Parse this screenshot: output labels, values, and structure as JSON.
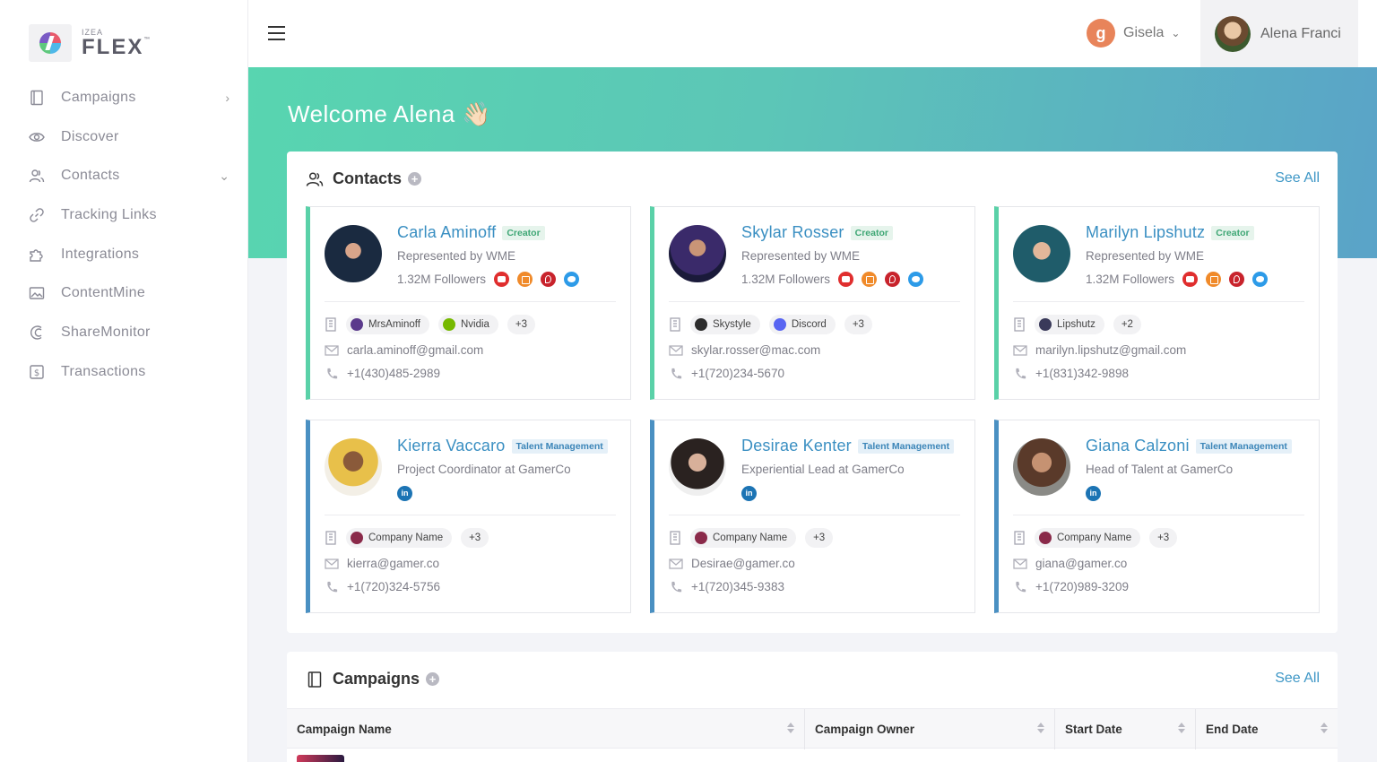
{
  "brand": {
    "small": "IZEA",
    "name": "FLEX",
    "tm": "™"
  },
  "sidebar": {
    "items": [
      {
        "label": "Campaigns",
        "icon": "book-icon",
        "chevron": "›"
      },
      {
        "label": "Discover",
        "icon": "eye-icon"
      },
      {
        "label": "Contacts",
        "icon": "users-icon",
        "chevron": "⌄"
      },
      {
        "label": "Tracking Links",
        "icon": "link-icon"
      },
      {
        "label": "Integrations",
        "icon": "puzzle-icon"
      },
      {
        "label": "ContentMine",
        "icon": "image-icon"
      },
      {
        "label": "ShareMonitor",
        "icon": "crescent-icon"
      },
      {
        "label": "Transactions",
        "icon": "dollar-icon"
      }
    ]
  },
  "topbar": {
    "org": {
      "initial": "g",
      "name": "Gisela",
      "color": "#e8845a"
    },
    "user": {
      "name": "Alena Franci"
    }
  },
  "banner": {
    "welcome": "Welcome Alena 👋🏻"
  },
  "contacts": {
    "title": "Contacts",
    "see_all": "See All",
    "cards": [
      {
        "name": "Carla Aminoff",
        "tag": "Creator",
        "subtitle": "Represented by WME",
        "followers": "1.32M Followers",
        "chips": [
          {
            "label": "MrsAminoff",
            "color": "#5b3a8c"
          },
          {
            "label": "Nvidia",
            "color": "#76b900"
          }
        ],
        "more": "+3",
        "email": "carla.aminoff@gmail.com",
        "phone": "+1(430)485-2989"
      },
      {
        "name": "Skylar Rosser",
        "tag": "Creator",
        "subtitle": "Represented by WME",
        "followers": "1.32M Followers",
        "chips": [
          {
            "label": "Skystyle",
            "color": "#2c2c2c"
          },
          {
            "label": "Discord",
            "color": "#5865f2"
          }
        ],
        "more": "+3",
        "email": "skylar.rosser@mac.com",
        "phone": "+1(720)234-5670"
      },
      {
        "name": "Marilyn Lipshutz",
        "tag": "Creator",
        "subtitle": "Represented by WME",
        "followers": "1.32M Followers",
        "chips": [
          {
            "label": "Lipshutz",
            "color": "#3a3a5a"
          }
        ],
        "more": "+2",
        "email": "marilyn.lipshutz@gmail.com",
        "phone": "+1(831)342-9898"
      },
      {
        "name": "Kierra Vaccaro",
        "tag": "Talent Management",
        "subtitle": "Project Coordinator at GamerCo",
        "linkedin": "in",
        "chips": [
          {
            "label": "Company Name",
            "color": "#8a2a4a"
          }
        ],
        "more": "+3",
        "email": "kierra@gamer.co",
        "phone": "+1(720)324-5756"
      },
      {
        "name": "Desirae Kenter",
        "tag": "Talent Management",
        "subtitle": "Experiential Lead at GamerCo",
        "linkedin": "in",
        "chips": [
          {
            "label": "Company Name",
            "color": "#8a2a4a"
          }
        ],
        "more": "+3",
        "email": "Desirae@gamer.co",
        "phone": "+1(720)345-9383"
      },
      {
        "name": "Giana Calzoni",
        "tag": "Talent Management",
        "subtitle": "Head of Talent at GamerCo",
        "linkedin": "in",
        "chips": [
          {
            "label": "Company Name",
            "color": "#8a2a4a"
          }
        ],
        "more": "+3",
        "email": "giana@gamer.co",
        "phone": "+1(720)989-3209"
      }
    ]
  },
  "campaigns": {
    "title": "Campaigns",
    "see_all": "See All",
    "columns": [
      "Campaign Name",
      "Campaign Owner",
      "Start Date",
      "End Date"
    ]
  }
}
